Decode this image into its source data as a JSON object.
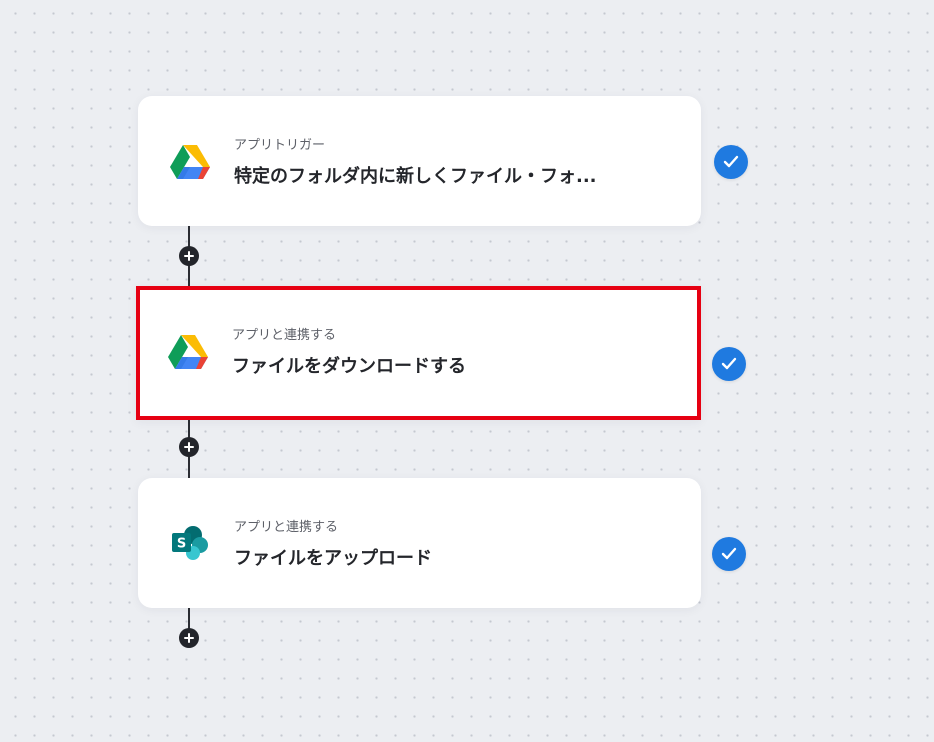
{
  "steps": [
    {
      "subtitle": "アプリトリガー",
      "title": "特定のフォルダ内に新しくファイル・フォ...",
      "app_icon": "google-drive-icon",
      "status_icon": "check-circle-icon"
    },
    {
      "subtitle": "アプリと連携する",
      "title": "ファイルをダウンロードする",
      "app_icon": "google-drive-icon",
      "status_icon": "check-circle-icon",
      "highlight_color": "#e60012"
    },
    {
      "subtitle": "アプリと連携する",
      "title": "ファイルをアップロード",
      "app_icon": "sharepoint-icon",
      "status_icon": "check-circle-icon"
    }
  ],
  "add_step_icon": "plus-circle-icon",
  "colors": {
    "background": "#eceef2",
    "card": "#ffffff",
    "check": "#1f7ae0",
    "highlight": "#e60012",
    "connector": "#2b2d33"
  }
}
